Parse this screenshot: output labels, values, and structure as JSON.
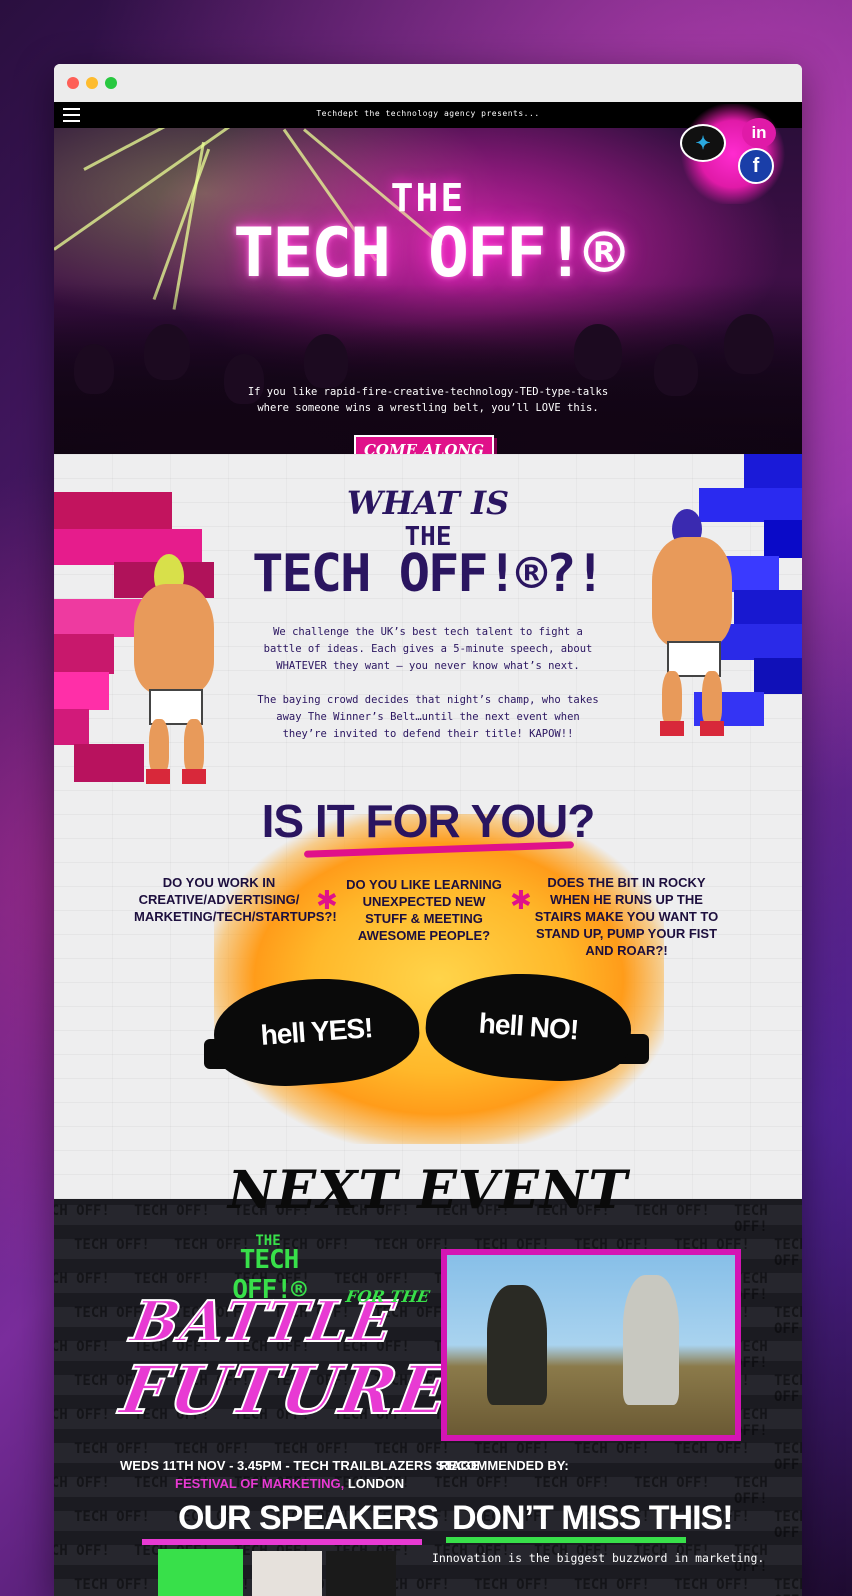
{
  "topbar": {
    "menu_label": "menu",
    "tagline": "Techdept the technology agency presents..."
  },
  "social": {
    "twitter_glyph": "✦",
    "linkedin_glyph": "in",
    "facebook_glyph": "f",
    "icons": [
      "twitter-icon",
      "linkedin-icon",
      "facebook-icon"
    ]
  },
  "hero": {
    "logo_the": "THE",
    "logo_main": "TECH OFF!®",
    "tagline_line1": "If you like rapid-fire-creative-technology-TED-type-talks",
    "tagline_line2": "where someone wins a wrestling belt, you’ll LOVE this.",
    "cta": "COME ALONG"
  },
  "what": {
    "heading_small": "WHAT IS",
    "heading_the": "THE",
    "heading_main": "TECH OFF!®?!",
    "para1": "We challenge the UK’s best tech talent to fight a battle of ideas. Each gives a 5-minute speech, about WHATEVER they want – you never know what’s next.",
    "para2": "The baying crowd decides that night’s champ, who takes away The Winner’s Belt…until the next event when they’re invited to defend their title! KAPOW!!"
  },
  "foryou": {
    "heading": "IS IT FOR YOU?",
    "q1": "Do you work in creative/advertising/ marketing/tech/startups?!",
    "q2": "Do you like learning unexpected new stuff & meeting awesome people?",
    "q3": "Does the bit in Rocky when he runs up the stairs make you want to stand up, pump your fist and roar?!",
    "separator": "✱",
    "yes_label": "hell YES!",
    "no_label": "hell NO!"
  },
  "next_event": {
    "heading": "NEXT EVENT",
    "watermark": "TECH OFF!",
    "logo_the": "THE",
    "logo_main": "TECH OFF!®",
    "title_line1": "BATTLE",
    "title_forthe": "FOR THE",
    "title_line2": "FUTURE",
    "date_line": "WEDS 11TH NOV - 3.45PM - TECH TRAILBLAZERS STAGE",
    "venue_pink": "FESTIVAL OF MARKETING,",
    "venue_white": " LONDON",
    "recommended": "RECOMMENDED BY:",
    "speakers_heading": "OUR SPEAKERS",
    "dont_miss_heading": "DON’T MISS THIS!",
    "dont_miss_text": "Innovation is the biggest buzzword in marketing."
  },
  "colors": {
    "accent_pink": "#e0118a",
    "accent_green": "#38e04a",
    "navy": "#2a1560"
  }
}
